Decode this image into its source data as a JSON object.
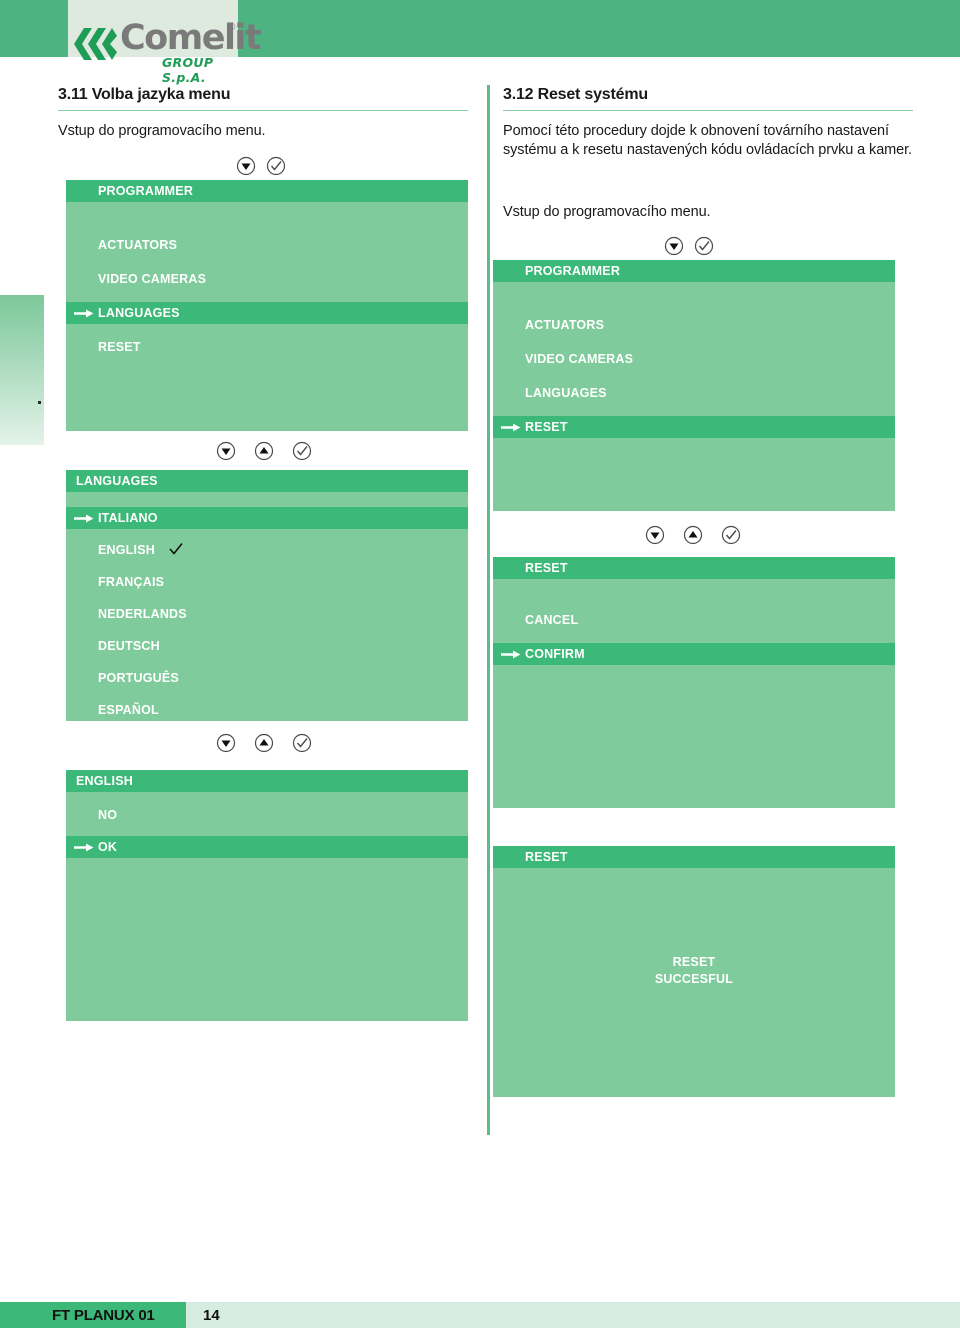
{
  "brand": {
    "name": "Comelit",
    "registered": "®",
    "subtitle": "GROUP S.p.A."
  },
  "left_column": {
    "section_title": "3.11 Volba jazyka menu",
    "intro": "Vstup do programovacího menu.",
    "screens": [
      {
        "title": "PROGRAMMER",
        "items": [
          {
            "label": "ACTUATORS",
            "selected": false,
            "checked": false
          },
          {
            "label": "VIDEO CAMERAS",
            "selected": false,
            "checked": false
          },
          {
            "label": "LANGUAGES",
            "selected": true,
            "checked": false
          },
          {
            "label": "RESET",
            "selected": false,
            "checked": false
          }
        ]
      },
      {
        "title": "LANGUAGES",
        "items": [
          {
            "label": "ITALIANO",
            "selected": true,
            "checked": false
          },
          {
            "label": "ENGLISH",
            "selected": false,
            "checked": true
          },
          {
            "label": "FRANÇAIS",
            "selected": false,
            "checked": false
          },
          {
            "label": "NEDERLANDS",
            "selected": false,
            "checked": false
          },
          {
            "label": "DEUTSCH",
            "selected": false,
            "checked": false
          },
          {
            "label": "PORTUGUÊS",
            "selected": false,
            "checked": false
          },
          {
            "label": "ESPAÑOL",
            "selected": false,
            "checked": false
          }
        ]
      },
      {
        "title": "ENGLISH",
        "items": [
          {
            "label": "NO",
            "selected": false,
            "checked": false
          },
          {
            "label": "OK",
            "selected": true,
            "checked": false
          }
        ]
      }
    ]
  },
  "right_column": {
    "section_title": "3.12 Reset systému",
    "description_line1": "Pomocí této procedury dojde k obnovení továrního nastavení",
    "description_line2": "systému a k resetu nastavených kódu ovládacích prvku a kamer.",
    "intro": "Vstup do programovacího menu.",
    "screens": [
      {
        "title": "PROGRAMMER",
        "items": [
          {
            "label": "ACTUATORS",
            "selected": false,
            "checked": false
          },
          {
            "label": "VIDEO CAMERAS",
            "selected": false,
            "checked": false
          },
          {
            "label": "LANGUAGES",
            "selected": false,
            "checked": false
          },
          {
            "label": "RESET",
            "selected": true,
            "checked": false
          }
        ]
      },
      {
        "title": "RESET",
        "items": [
          {
            "label": "CANCEL",
            "selected": false,
            "checked": false
          },
          {
            "label": "CONFIRM",
            "selected": true,
            "checked": false
          }
        ]
      },
      {
        "title": "RESET",
        "message_line1": "RESET",
        "message_line2": "SUCCESFUL",
        "items": []
      }
    ]
  },
  "icons": {
    "down": "down-arrow-button-icon",
    "up": "up-arrow-button-icon",
    "confirm": "check-button-icon",
    "marker": "selection-arrow-icon",
    "tick": "checkmark-icon"
  },
  "footer": {
    "document_code": "FT PLANUX 01",
    "page_number": "14"
  },
  "colors": {
    "header_green": "#3cb878",
    "screen_green": "#7fcb9b",
    "banner_green": "#4cb381",
    "footer_light": "#d7ece0",
    "logo_gray": "#7a7a7a",
    "logo_green": "#1f9d57"
  }
}
